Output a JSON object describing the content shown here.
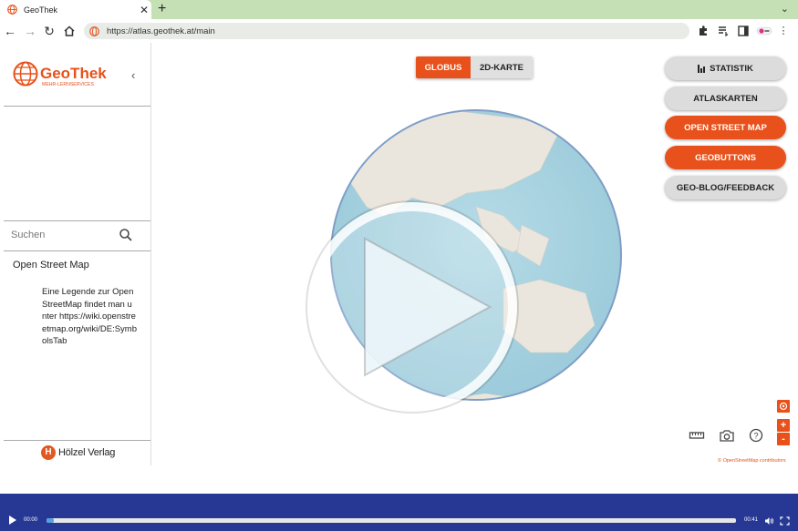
{
  "browser": {
    "tab_title": "GeoThek",
    "url": "https://atlas.geothek.at/main",
    "tab_close": "✕",
    "new_tab": "+"
  },
  "sidebar": {
    "logo_text": "GeoThek",
    "logo_subtitle": "MEHR-LERNSERVICES",
    "search_placeholder": "Suchen",
    "section_title": "Open Street Map",
    "legend_text": "Eine Legende zur OpenStreetMap findet man unter https://wiki.openstreetmap.org/wiki/DE:SymbolsTab",
    "publisher": "Hölzel Verlag",
    "publisher_initial": "H"
  },
  "view_toggle": {
    "active": "GLOBUS",
    "inactive": "2D-KARTE"
  },
  "right_menu": [
    {
      "label": "STATISTIK",
      "style": "grey",
      "icon": "bar-chart-icon"
    },
    {
      "label": "ATLASKARTEN",
      "style": "grey"
    },
    {
      "label": "OPEN STREET MAP",
      "style": "orange"
    },
    {
      "label": "GEOBUTTONS",
      "style": "orange"
    },
    {
      "label": "GEO-BLOG/FEEDBACK",
      "style": "grey"
    }
  ],
  "map": {
    "attribution": "© OpenStreetMap contributors",
    "zoom_in": "+",
    "zoom_out": "-",
    "tools": [
      "ruler-icon",
      "camera-icon",
      "help-icon",
      "location-icon"
    ]
  },
  "video": {
    "current_time": "00:00",
    "total_time": "00:41",
    "progress": 0.01
  },
  "colors": {
    "brand_orange": "#e8511b",
    "tab_bar": "#c6e0b6",
    "video_bar": "#263894",
    "globe_ocean": "#a9d3e0"
  }
}
